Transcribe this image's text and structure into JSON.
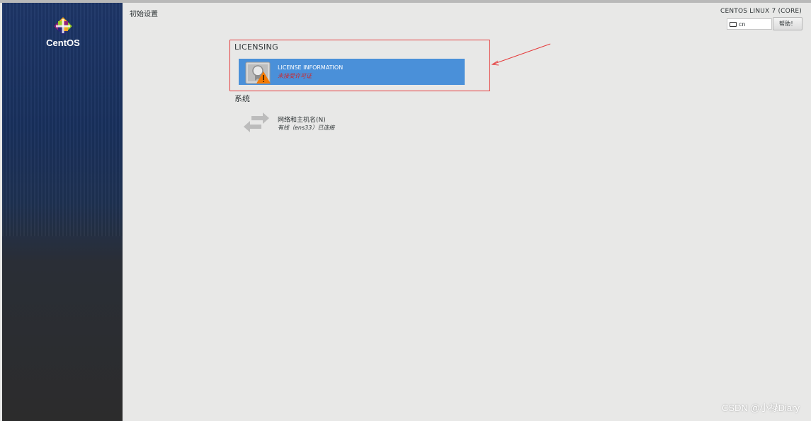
{
  "sidebar": {
    "logo_text": "CentOS"
  },
  "header": {
    "title": "初始设置",
    "product": "CENTOS LINUX 7 (CORE)",
    "keyboard_layout": "cn",
    "help_label": "帮助！"
  },
  "sections": {
    "licensing": {
      "title": "LICENSING",
      "spoke": {
        "label": "LICENSE INFORMATION",
        "status": "未接受许可证"
      }
    },
    "system": {
      "title": "系统",
      "spoke": {
        "label": "网络和主机名(N)",
        "status": "有线（ens33）已连接"
      }
    }
  },
  "watermark": "CSDN @小禄Diary",
  "icons": {
    "logo": "centos-logo-icon",
    "keyboard": "keyboard-icon",
    "license": "license-warning-icon",
    "network": "network-arrows-icon"
  },
  "colors": {
    "accent": "#4a90d9",
    "warning": "#f57900",
    "error_text": "#d0262a",
    "annotation": "#e53c3c"
  }
}
